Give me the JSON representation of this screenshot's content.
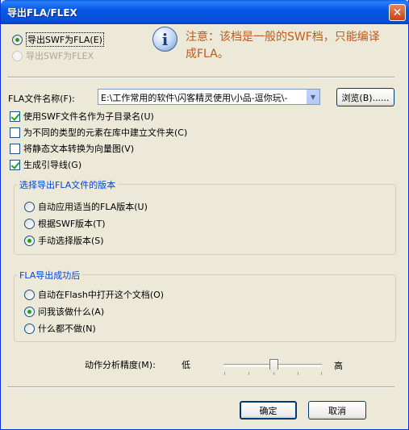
{
  "window": {
    "title": "导出FLA/FLEX",
    "close_glyph": "✕"
  },
  "export_mode": {
    "fla_label": "导出SWF为FLA(E)",
    "flex_label": "导出SWF为FLEX"
  },
  "info": {
    "icon": "info-icon",
    "line1": "注意：该档是一般的SWF档，只能编译",
    "line2": "成FLA。"
  },
  "file": {
    "label": "FLA文件名称(F):",
    "value": "E:\\工作常用的软件\\闪客精灵使用\\小品-逗你玩\\-",
    "browse_label": "浏览(B)......"
  },
  "options": [
    {
      "label": "使用SWF文件名作为子目录名(U)",
      "checked": true
    },
    {
      "label": "为不同的类型的元素在库中建立文件夹(C)",
      "checked": false
    },
    {
      "label": "将静态文本转换为向量图(V)",
      "checked": false
    },
    {
      "label": "生成引导线(G)",
      "checked": true
    }
  ],
  "version_group": {
    "title": "选择导出FLA文件的版本",
    "options": [
      {
        "label": "自动应用适当的FLA版本(U)",
        "checked": false
      },
      {
        "label": "根据SWF版本(T)",
        "checked": false
      },
      {
        "label": "手动选择版本(S)",
        "checked": true
      }
    ]
  },
  "after_group": {
    "title": "FLA导出成功后",
    "options": [
      {
        "label": "自动在Flash中打开这个文档(O)",
        "checked": false
      },
      {
        "label": "问我该做什么(A)",
        "checked": true
      },
      {
        "label": "什么都不做(N)",
        "checked": false
      }
    ]
  },
  "precision": {
    "label": "动作分析精度(M):",
    "low": "低",
    "high": "高",
    "level": 0.5
  },
  "buttons": {
    "ok": "确定",
    "cancel": "取消"
  },
  "colors": {
    "titlebar": "#0550D9",
    "note_text": "#C05A1C",
    "group_title": "#0046D5",
    "check_green": "#21A121"
  }
}
